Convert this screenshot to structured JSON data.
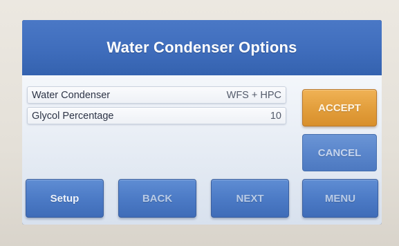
{
  "screen": {
    "title": "Water Condenser Options"
  },
  "fields": [
    {
      "label": "Water Condenser",
      "value": "WFS + HPC"
    },
    {
      "label": "Glycol Percentage",
      "value": "10"
    }
  ],
  "buttons": {
    "accept": "ACCEPT",
    "cancel": "CANCEL",
    "setup": "Setup",
    "back": "BACK",
    "next": "NEXT",
    "menu": "MENU"
  },
  "colors": {
    "title_bar": "#4272bf",
    "button_blue": "#4c7bc6",
    "button_accept": "#e39f3d",
    "content_bg": "#e6ecf4"
  }
}
